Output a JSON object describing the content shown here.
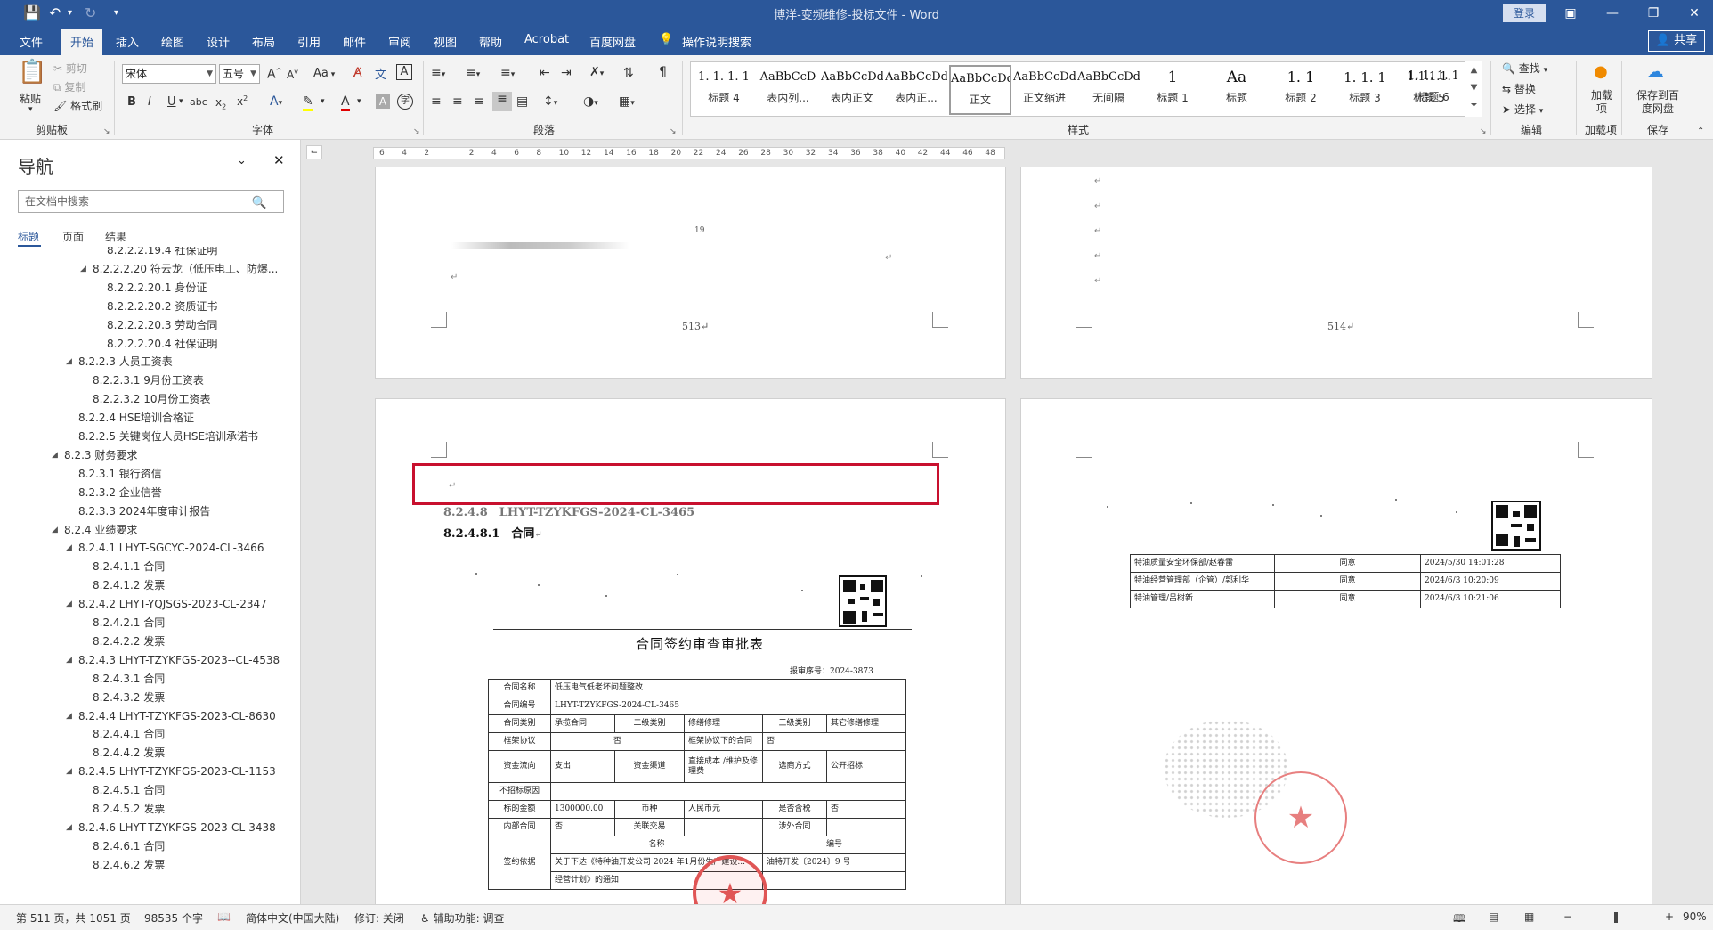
{
  "window": {
    "title": "博洋-变频维修-投标文件 - Word",
    "login_label": "登录",
    "share_label": "共享",
    "icons": [
      "save-icon",
      "undo-icon",
      "redo-icon",
      "customize-quick-access-icon",
      "ribbon-display-options-icon",
      "minimize-icon",
      "restore-icon",
      "close-icon"
    ]
  },
  "menu": {
    "tabs": [
      {
        "label": "文件"
      },
      {
        "label": "开始"
      },
      {
        "label": "插入"
      },
      {
        "label": "绘图"
      },
      {
        "label": "设计"
      },
      {
        "label": "布局"
      },
      {
        "label": "引用"
      },
      {
        "label": "邮件"
      },
      {
        "label": "审阅"
      },
      {
        "label": "视图"
      },
      {
        "label": "帮助"
      },
      {
        "label": "Acrobat"
      },
      {
        "label": "百度网盘"
      }
    ],
    "active_tab": "开始",
    "tell_me": "操作说明搜索"
  },
  "ribbon": {
    "clipboard": {
      "paste": "粘贴",
      "cut": "剪切",
      "copy": "复制",
      "format_painter": "格式刷",
      "group": "剪贴板"
    },
    "font": {
      "name": "宋体",
      "size": "五号",
      "group": "字体",
      "grow": "A",
      "shrink": "A",
      "case": "Aa",
      "bold": "B",
      "italic": "I",
      "underline": "U",
      "strike": "abc",
      "sub": "x",
      "sup": "x"
    },
    "paragraph": {
      "group": "段落"
    },
    "styles": {
      "group": "样式",
      "items": [
        {
          "preview": "1. 1. 1. 1",
          "name": "标题 4"
        },
        {
          "preview": "AaBbCcD",
          "name": "表内列..."
        },
        {
          "preview": "AaBbCcDdI",
          "name": "表内正文"
        },
        {
          "preview": "AaBbCcDdI",
          "name": "表内正..."
        },
        {
          "preview": "AaBbCcDdI",
          "name": "正文"
        },
        {
          "preview": "AaBbCcDdI",
          "name": "正文缩进"
        },
        {
          "preview": "AaBbCcDdI",
          "name": "无间隔"
        },
        {
          "preview": "1",
          "name": "标题 1"
        },
        {
          "preview": "Aa",
          "name": "标题"
        },
        {
          "preview": "1. 1",
          "name": "标题 2"
        },
        {
          "preview": "1. 1. 1",
          "name": "标题 3"
        },
        {
          "preview": "1.1.1.1.",
          "name": "标题 5"
        },
        {
          "preview": "1. 1. 1. 1",
          "name": "标题 6"
        }
      ],
      "selected": "正文"
    },
    "editing": {
      "find": "查找",
      "replace": "替换",
      "select": "选择",
      "group": "编辑"
    },
    "addins": {
      "label": "加载项",
      "group": "加载项"
    },
    "save": {
      "label": "保存到百度网盘",
      "group": "保存"
    }
  },
  "nav": {
    "title": "导航",
    "search_placeholder": "在文档中搜索",
    "tabs": [
      {
        "label": "标题"
      },
      {
        "label": "页面"
      },
      {
        "label": "结果"
      }
    ],
    "active_tab": "标题",
    "items": [
      {
        "label": "8.2.2.2.19.4 社保证明",
        "level": 4,
        "collapsed": false
      },
      {
        "label": "8.2.2.2.20 符云龙（低压电工、防爆...",
        "level": 3,
        "collapsed": false,
        "expander": true
      },
      {
        "label": "8.2.2.2.20.1 身份证",
        "level": 4
      },
      {
        "label": "8.2.2.2.20.2 资质证书",
        "level": 4
      },
      {
        "label": "8.2.2.2.20.3 劳动合同",
        "level": 4
      },
      {
        "label": "8.2.2.2.20.4 社保证明",
        "level": 4
      },
      {
        "label": "8.2.2.3 人员工资表",
        "level": 2,
        "expander": true
      },
      {
        "label": "8.2.2.3.1 9月份工资表",
        "level": 3
      },
      {
        "label": "8.2.2.3.2 10月份工资表",
        "level": 3
      },
      {
        "label": "8.2.2.4 HSE培训合格证",
        "level": 2
      },
      {
        "label": "8.2.2.5 关键岗位人员HSE培训承诺书",
        "level": 2
      },
      {
        "label": "8.2.3 财务要求",
        "level": 1,
        "expander": true
      },
      {
        "label": "8.2.3.1 银行资信",
        "level": 2
      },
      {
        "label": "8.2.3.2 企业信誉",
        "level": 2
      },
      {
        "label": "8.2.3.3 2024年度审计报告",
        "level": 2
      },
      {
        "label": "8.2.4 业绩要求",
        "level": 1,
        "expander": true
      },
      {
        "label": "8.2.4.1 LHYT-SGCYC-2024-CL-3466",
        "level": 2,
        "expander": true
      },
      {
        "label": "8.2.4.1.1 合同",
        "level": 3
      },
      {
        "label": "8.2.4.1.2 发票",
        "level": 3
      },
      {
        "label": "8.2.4.2 LHYT-YQJSGS-2023-CL-2347",
        "level": 2,
        "expander": true
      },
      {
        "label": "8.2.4.2.1 合同",
        "level": 3
      },
      {
        "label": "8.2.4.2.2 发票",
        "level": 3
      },
      {
        "label": "8.2.4.3 LHYT-TZYKFGS-2023--CL-4538",
        "level": 2,
        "expander": true
      },
      {
        "label": "8.2.4.3.1 合同",
        "level": 3
      },
      {
        "label": "8.2.4.3.2 发票",
        "level": 3
      },
      {
        "label": "8.2.4.4 LHYT-TZYKFGS-2023-CL-8630",
        "level": 2,
        "expander": true
      },
      {
        "label": "8.2.4.4.1 合同",
        "level": 3
      },
      {
        "label": "8.2.4.4.2 发票",
        "level": 3
      },
      {
        "label": "8.2.4.5 LHYT-TZYKFGS-2023-CL-1153",
        "level": 2,
        "expander": true
      },
      {
        "label": "8.2.4.5.1 合同",
        "level": 3
      },
      {
        "label": "8.2.4.5.2 发票",
        "level": 3
      },
      {
        "label": "8.2.4.6 LHYT-TZYKFGS-2023-CL-3438",
        "level": 2,
        "expander": true
      },
      {
        "label": "8.2.4.6.1 合同",
        "level": 3
      },
      {
        "label": "8.2.4.6.2 发票",
        "level": 3
      }
    ]
  },
  "ruler": {
    "labels": [
      "6",
      "4",
      "2",
      "",
      "2",
      "4",
      "6",
      "8",
      "10",
      "12",
      "14",
      "16",
      "18",
      "20",
      "22",
      "24",
      "26",
      "28",
      "30",
      "32",
      "34",
      "36",
      "38",
      "40",
      "42",
      "44",
      "46",
      "48"
    ]
  },
  "document": {
    "page513": {
      "number": "513",
      "fragment": "19"
    },
    "page514": {
      "number": "514"
    },
    "page515": {
      "heading1": "8.2.4.8　LHYT-TZYKFGS-2024-CL-3465",
      "heading2": "8.2.4.8.1　合同",
      "form_title": "合同签约审查审批表",
      "serial": "报审序号：2024-3873",
      "rows": {
        "r1": [
          "合同名称",
          "低压电气低老坏问题整改"
        ],
        "r2": [
          "合同编号",
          "LHYT-TZYKFGS-2024-CL-3465"
        ],
        "r3": [
          "合同类别",
          "承揽合同",
          "二级类别",
          "修缮修理",
          "三级类别",
          "其它修缮修理"
        ],
        "r4": [
          "框架协议",
          "否",
          "框架协议下的合同",
          "否"
        ],
        "r5": [
          "资金流向",
          "支出",
          "资金渠道",
          "直接成本 /维护及修理费",
          "选商方式",
          "公开招标"
        ],
        "r6": [
          "不招标原因"
        ],
        "r7": [
          "标的金额",
          "1300000.00",
          "币种",
          "人民币元",
          "是否含税",
          "否"
        ],
        "r8": [
          "内部合同",
          "否",
          "关联交易",
          "",
          "涉外合同",
          ""
        ],
        "r9": [
          "签约依据",
          "名称",
          "编号"
        ],
        "r10": [
          "",
          "关于下达《特种油开发公司 2024 年1月份生产建设...",
          "油特开发〔2024〕9 号"
        ],
        "r11": [
          "",
          "经营计划》的通知",
          ""
        ]
      }
    },
    "page516": {
      "approvals": [
        [
          "特油质量安全环保部/赵春雷",
          "同意",
          "2024/5/30 14:01:28"
        ],
        [
          "特油经营管理部（企管）/郭利华",
          "同意",
          "2024/6/3 10:20:09"
        ],
        [
          "特油管理/吕树新",
          "同意",
          "2024/6/3 10:21:06"
        ]
      ]
    }
  },
  "status": {
    "page": "第 511 页，共 1051 页",
    "words": "98535 个字",
    "language": "简体中文(中国大陆)",
    "track": "修订: 关闭",
    "accessibility": "辅助功能: 调查",
    "zoom": "90%"
  },
  "colors": {
    "brand": "#2b579a",
    "highlight": "#c8102e",
    "stamp": "#e05555"
  }
}
